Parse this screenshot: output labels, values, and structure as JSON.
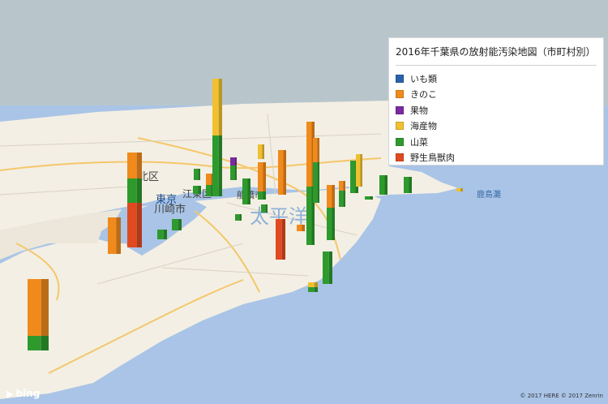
{
  "legend": {
    "title": "2016年千葉県の放射能汚染地図（市町村別）",
    "items": [
      {
        "label": "いも類",
        "color": "#2a62a8"
      },
      {
        "label": "きのこ",
        "color": "#f08a1c"
      },
      {
        "label": "果物",
        "color": "#7b2aa0"
      },
      {
        "label": "海産物",
        "color": "#f0c030"
      },
      {
        "label": "山菜",
        "color": "#2e9a2e"
      },
      {
        "label": "野生鳥獣肉",
        "color": "#e04a20"
      }
    ]
  },
  "map_labels": {
    "place_1": "北区",
    "place_2": "江東区",
    "place_3": "東京",
    "place_4": "川崎市",
    "place_5": "船橋市",
    "place_6": "鹿島灘",
    "place_7": "太平洋"
  },
  "attribution": {
    "brand": "bing",
    "copyright": "© 2017 HERE  © 2017 Zenrin"
  },
  "colors": {
    "sky": "#b8c6cc",
    "sea": "#a9c4e6",
    "land": "#f3efe4"
  }
}
